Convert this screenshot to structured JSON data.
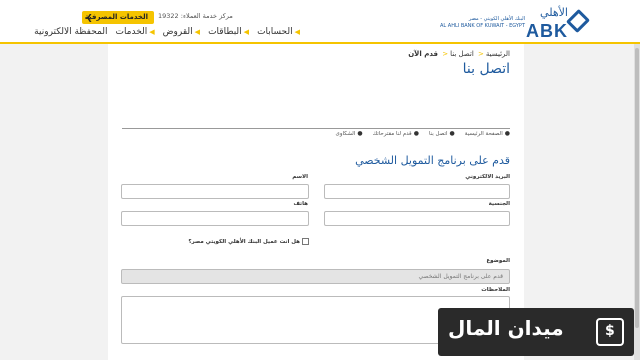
{
  "header": {
    "logo_ar": "الأهلي",
    "logo_en": "ABK",
    "logo_sub_ar": "البنك الأهلي الكويتي - مصر",
    "logo_sub_en": "AL AHLI BANK OF KUWAIT - EGYPT",
    "banking_services_label": "الخدمات المصرفية",
    "hotline": "مركز خدمة العملاء: 19322",
    "nav": [
      "الحسابات",
      "البطاقات",
      "القروض",
      "الخدمات",
      "المحفظة الالكترونية"
    ]
  },
  "breadcrumb": {
    "items": [
      "الرئيسية",
      "اتصل بنا",
      "قدم الآن"
    ]
  },
  "page_title": "اتصل بنا",
  "timeline": [
    "الصفحة الرئيسية",
    "اتصل بنا",
    "قدم لنا مقترحاتك",
    "الشكاوى"
  ],
  "form": {
    "section_title": "قدم على برنامج التمويل الشخصي",
    "email_label": "البريد الالكتروني",
    "name_label": "الاسم",
    "nationality_label": "الجنسية",
    "phone_label": "هاتف",
    "customer_question": "هل انت عميل البنك الأهلي الكويتي مصر؟",
    "subject_label": "الموضوع",
    "subject_value": "قدم على برنامج التمويل الشخصي",
    "notes_label": "الملاحظات"
  },
  "watermark": {
    "text": "ميدان المال",
    "icon": "money-icon"
  },
  "colors": {
    "accent": "#f5c400",
    "brand": "#1e5a9e"
  }
}
